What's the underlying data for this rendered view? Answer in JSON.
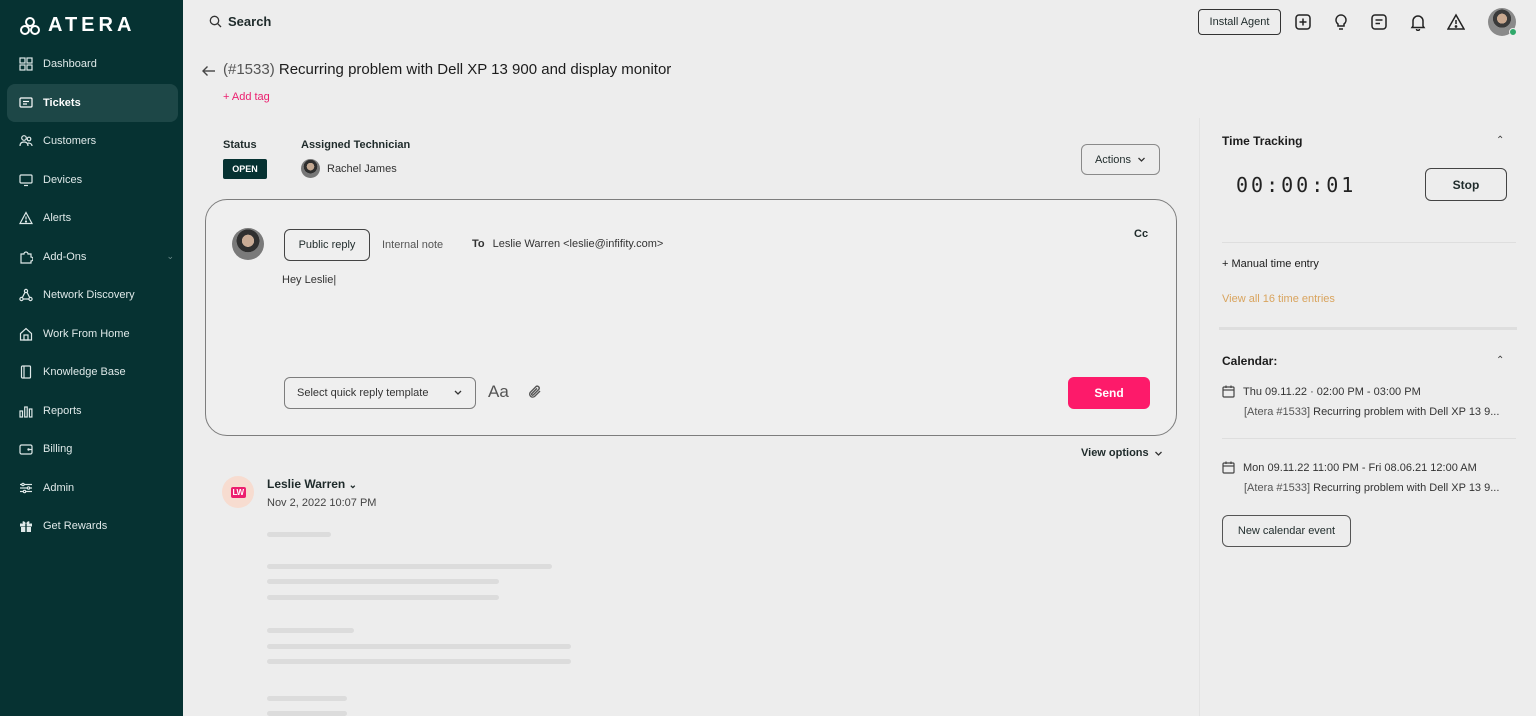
{
  "brand": {
    "name": "ATERA"
  },
  "sidebar": {
    "items": [
      {
        "label": "Dashboard",
        "icon": "grid-icon",
        "active": false
      },
      {
        "label": "Tickets",
        "icon": "ticket-icon",
        "active": true
      },
      {
        "label": "Customers",
        "icon": "customers-icon",
        "active": false
      },
      {
        "label": "Devices",
        "icon": "monitor-icon",
        "active": false
      },
      {
        "label": "Alerts",
        "icon": "warning-icon",
        "active": false
      },
      {
        "label": "Add-Ons",
        "icon": "puzzle-icon",
        "active": false,
        "expandable": true
      },
      {
        "label": "Network Discovery",
        "icon": "network-icon",
        "active": false
      },
      {
        "label": "Work From Home",
        "icon": "home-icon",
        "active": false
      },
      {
        "label": "Knowledge Base",
        "icon": "book-icon",
        "active": false
      },
      {
        "label": "Reports",
        "icon": "bar-chart-icon",
        "active": false
      },
      {
        "label": "Billing",
        "icon": "billing-icon",
        "active": false
      },
      {
        "label": "Admin",
        "icon": "sliders-icon",
        "active": false
      },
      {
        "label": "Get Rewards",
        "icon": "gift-icon",
        "active": false
      }
    ]
  },
  "topbar": {
    "search_label": "Search",
    "install_agent_label": "Install Agent"
  },
  "ticket": {
    "number": "(#1533)",
    "title": "Recurring problem with Dell XP 13 900 and display monitor",
    "add_tag": "+ Add tag",
    "status_label": "Status",
    "status_value": "OPEN",
    "tech_label": "Assigned Technician",
    "tech_name": "Rachel James",
    "actions_label": "Actions"
  },
  "reply": {
    "public_reply": "Public reply",
    "internal_note": "Internal note",
    "to_label": "To",
    "to_value": "Leslie Warren <leslie@infifity.com>",
    "cc_label": "Cc",
    "body": "Hey Leslie|",
    "template_placeholder": "Select quick reply template",
    "font_icon_text": "Aa",
    "send_label": "Send"
  },
  "view_options": "View options",
  "message": {
    "author": "Leslie Warren",
    "initials": "LW",
    "date": "Nov 2, 2022 10:07 PM"
  },
  "time_tracking": {
    "title": "Time Tracking",
    "timer": "00:00:01",
    "stop_label": "Stop",
    "manual_entry": "+ Manual time entry",
    "view_all": "View all 16 time entries"
  },
  "calendar": {
    "title": "Calendar:",
    "events": [
      {
        "when": "Thu 09.11.22  ·  02:00 PM - 03:00 PM",
        "tag": "[Atera #1533]",
        "subject": "Recurring problem with Dell XP 13 9..."
      },
      {
        "when": "Mon 09.11.22 11:00 PM - Fri 08.06.21 12:00 AM",
        "tag": "[Atera #1533]",
        "subject": "Recurring problem with Dell XP 13 9..."
      }
    ],
    "new_event": "New calendar event"
  },
  "colors": {
    "sidebar_bg": "#063232",
    "accent_pink": "#fd1a6a",
    "link_orange": "#d9a45e",
    "status_badge_bg": "#063232"
  }
}
